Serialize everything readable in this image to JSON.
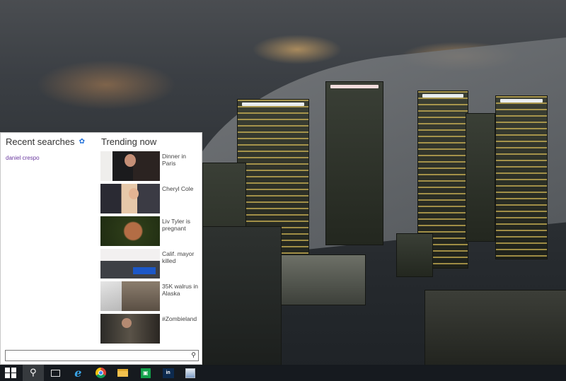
{
  "search_panel": {
    "recent": {
      "heading": "Recent searches",
      "items": [
        "daniel crespo"
      ]
    },
    "trending": {
      "heading": "Trending now",
      "items": [
        {
          "caption": "Dinner in Paris"
        },
        {
          "caption": "Cheryl Cole"
        },
        {
          "caption": "Liv Tyler is pregnant"
        },
        {
          "caption": "Calif. mayor killed"
        },
        {
          "caption": "35K walrus in Alaska"
        },
        {
          "caption": "#Zombieland"
        }
      ]
    },
    "search_box": {
      "value": "",
      "placeholder": ""
    }
  },
  "taskbar": {
    "buttons": [
      {
        "icon": "windows-start-icon"
      },
      {
        "icon": "search-icon",
        "active": true
      },
      {
        "icon": "task-view-icon"
      },
      {
        "icon": "internet-explorer-icon"
      },
      {
        "icon": "chrome-icon"
      },
      {
        "icon": "file-explorer-icon"
      },
      {
        "icon": "store-icon"
      },
      {
        "icon": "app-icon"
      },
      {
        "icon": "app-icon-2"
      }
    ]
  },
  "colors": {
    "accent": "#1e6fd9",
    "recent_link": "#6b3aa0",
    "taskbar": "#161a1e"
  }
}
